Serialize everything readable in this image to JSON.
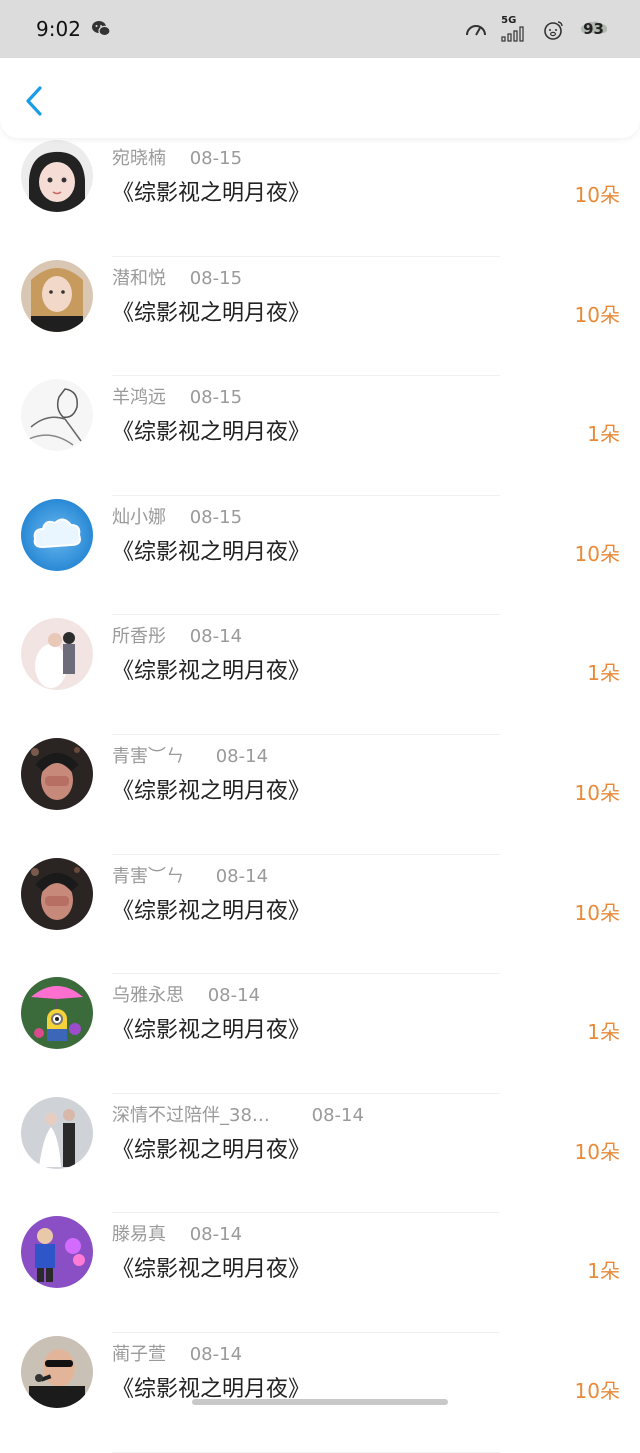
{
  "status_bar": {
    "time": "9:02",
    "network": "5G",
    "battery": "93"
  },
  "colors": {
    "accent_blue": "#1a9ce8",
    "amount_orange": "#e88a3a",
    "meta_gray": "#9a9a9a"
  },
  "records": [
    {
      "name": "宛晓楠",
      "date": "08-15",
      "title": "《综影视之明月夜》",
      "amount": "10朵",
      "avatar": "avatar-anime-girl"
    },
    {
      "name": "潜和悦",
      "date": "08-15",
      "title": "《综影视之明月夜》",
      "amount": "10朵",
      "avatar": "avatar-selfie-girl"
    },
    {
      "name": "羊鸿远",
      "date": "08-15",
      "title": "《综影视之明月夜》",
      "amount": "1朵",
      "avatar": "avatar-sketch-couple"
    },
    {
      "name": "灿小娜",
      "date": "08-15",
      "title": "《综影视之明月夜》",
      "amount": "10朵",
      "avatar": "avatar-cloud"
    },
    {
      "name": "所香彤",
      "date": "08-14",
      "title": "《综影视之明月夜》",
      "amount": "1朵",
      "avatar": "avatar-wedding-pink"
    },
    {
      "name": "青害︶ㄣ",
      "date": "08-14",
      "title": "《综影视之明月夜》",
      "amount": "10朵",
      "avatar": "avatar-dark-photo"
    },
    {
      "name": "青害︶ㄣ",
      "date": "08-14",
      "title": "《综影视之明月夜》",
      "amount": "10朵",
      "avatar": "avatar-dark-photo"
    },
    {
      "name": "乌雅永思",
      "date": "08-14",
      "title": "《综影视之明月夜》",
      "amount": "1朵",
      "avatar": "avatar-minion"
    },
    {
      "name": "深情不过陪伴_38…",
      "date": "08-14",
      "title": "《综影视之明月夜》",
      "amount": "10朵",
      "avatar": "avatar-wedding-couple"
    },
    {
      "name": "滕易真",
      "date": "08-14",
      "title": "《综影视之明月夜》",
      "amount": "1朵",
      "avatar": "avatar-kid-purple"
    },
    {
      "name": "蔺子萱",
      "date": "08-14",
      "title": "《综影视之明月夜》",
      "amount": "10朵",
      "avatar": "avatar-man-singing"
    }
  ]
}
